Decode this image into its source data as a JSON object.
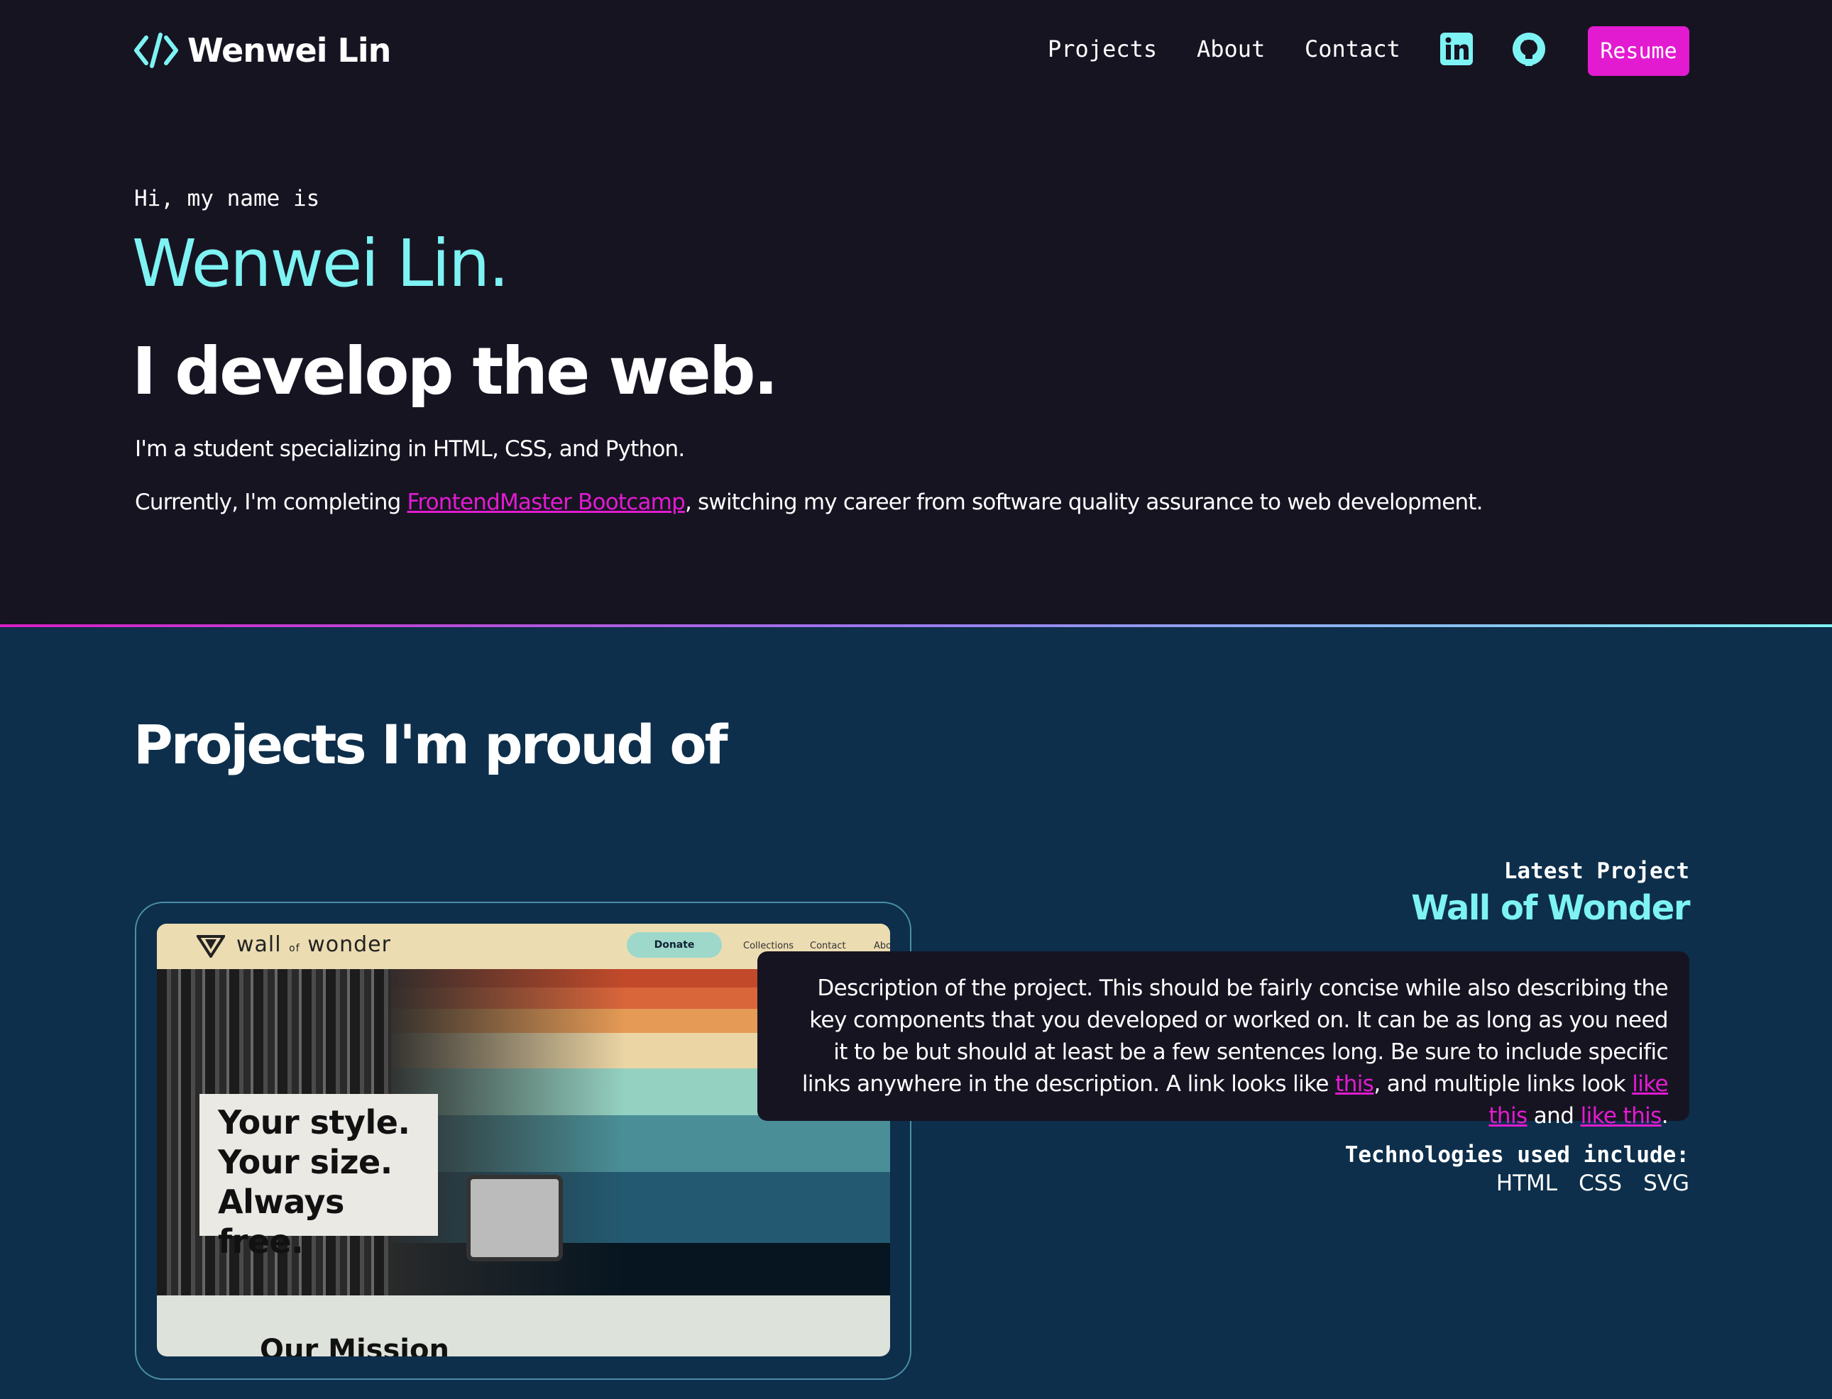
{
  "brand": {
    "name": "Wenwei Lin",
    "logo_icon": "code-brackets-icon"
  },
  "nav": {
    "links": [
      "Projects",
      "About",
      "Contact"
    ],
    "linkedin_icon": "linkedin-icon",
    "github_icon": "github-icon",
    "resume_label": "Resume"
  },
  "hero": {
    "greeting": "Hi, my name is",
    "name": "Wenwei Lin.",
    "tagline": "I develop the web.",
    "intro1": "I'm a student specializing in HTML, CSS, and Python.",
    "intro2_before": "Currently, I'm completing ",
    "intro2_link": "FrontendMaster Bootcamp",
    "intro2_after": ", switching my career from software quality assurance to web development."
  },
  "projects": {
    "title": "Projects I'm proud of",
    "latest_label": "Latest Project",
    "project_name": "Wall of Wonder",
    "description_text": "Description of the project. This should be fairly concise while also describing the key components that you developed or worked on. It can be as long as you need it to be but should at least be a few sentences long. Be sure to include specific links anywhere in the description. A link looks like ",
    "link1": "this",
    "desc_mid": ", and multiple links look ",
    "link2": "like this",
    "desc_and": " and ",
    "link3": "like this",
    "desc_end": ".",
    "tech_label": "Technologies used include:",
    "technologies": [
      "HTML",
      "CSS",
      "SVG"
    ],
    "screenshot": {
      "logo_main": "wall",
      "logo_of": "of",
      "logo_end": "wonder",
      "donate": "Donate",
      "nav": [
        "Collections",
        "Contact",
        "Abo"
      ],
      "callout": [
        "Your style.",
        "Your size.",
        "Always free."
      ],
      "mission": "Our Mission"
    }
  },
  "colors": {
    "accent_cyan": "#7ef3f3",
    "accent_pink": "#e21bd1",
    "hero_bg": "#171422",
    "section_bg": "#0d2f4b"
  }
}
